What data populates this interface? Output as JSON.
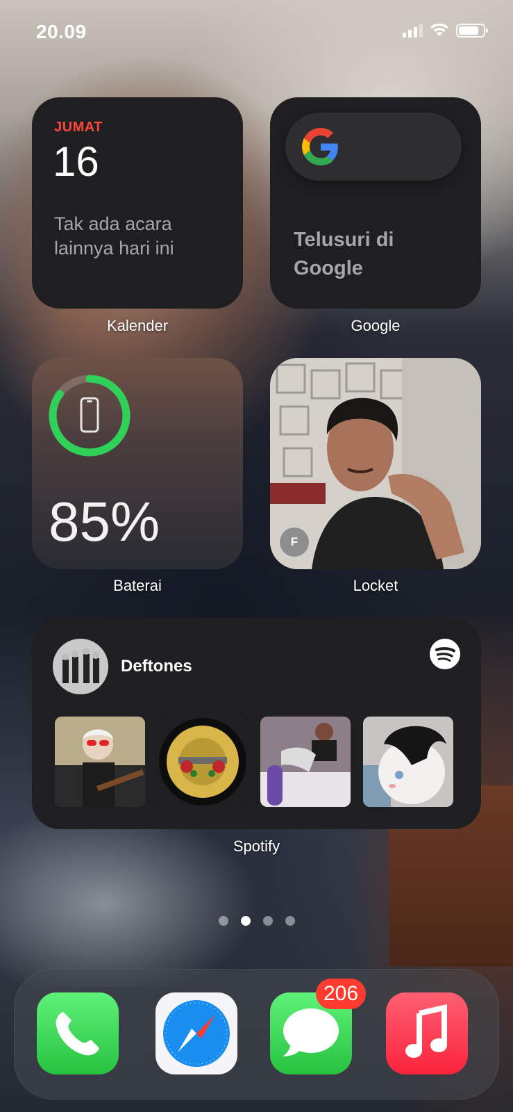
{
  "status_bar": {
    "time": "20.09",
    "icons": [
      "signal-icon",
      "wifi-icon",
      "battery-icon"
    ]
  },
  "widgets": {
    "calendar": {
      "day": "JUMAT",
      "date": "16",
      "note": "Tak ada acara lainnya hari ini",
      "label": "Kalender"
    },
    "google": {
      "text": "Telusuri di Google",
      "label": "Google"
    },
    "battery": {
      "percent": "85%",
      "level": 0.85,
      "label": "Baterai"
    },
    "locket": {
      "avatar_initial": "F",
      "label": "Locket"
    },
    "spotify": {
      "artist": "Deftones",
      "label": "Spotify",
      "tiles": [
        "album-tile-1",
        "album-tile-2",
        "album-tile-3",
        "album-tile-4"
      ]
    }
  },
  "page_dots": {
    "count": 4,
    "active_index": 1
  },
  "dock": {
    "apps": [
      "Phone",
      "Safari",
      "Messages",
      "Music"
    ],
    "messages_badge": "206"
  },
  "colors": {
    "calendar_accent": "#ff453a",
    "battery_ring": "#30d158",
    "badge": "#ff3b30",
    "spotify_green": "#1db954"
  }
}
